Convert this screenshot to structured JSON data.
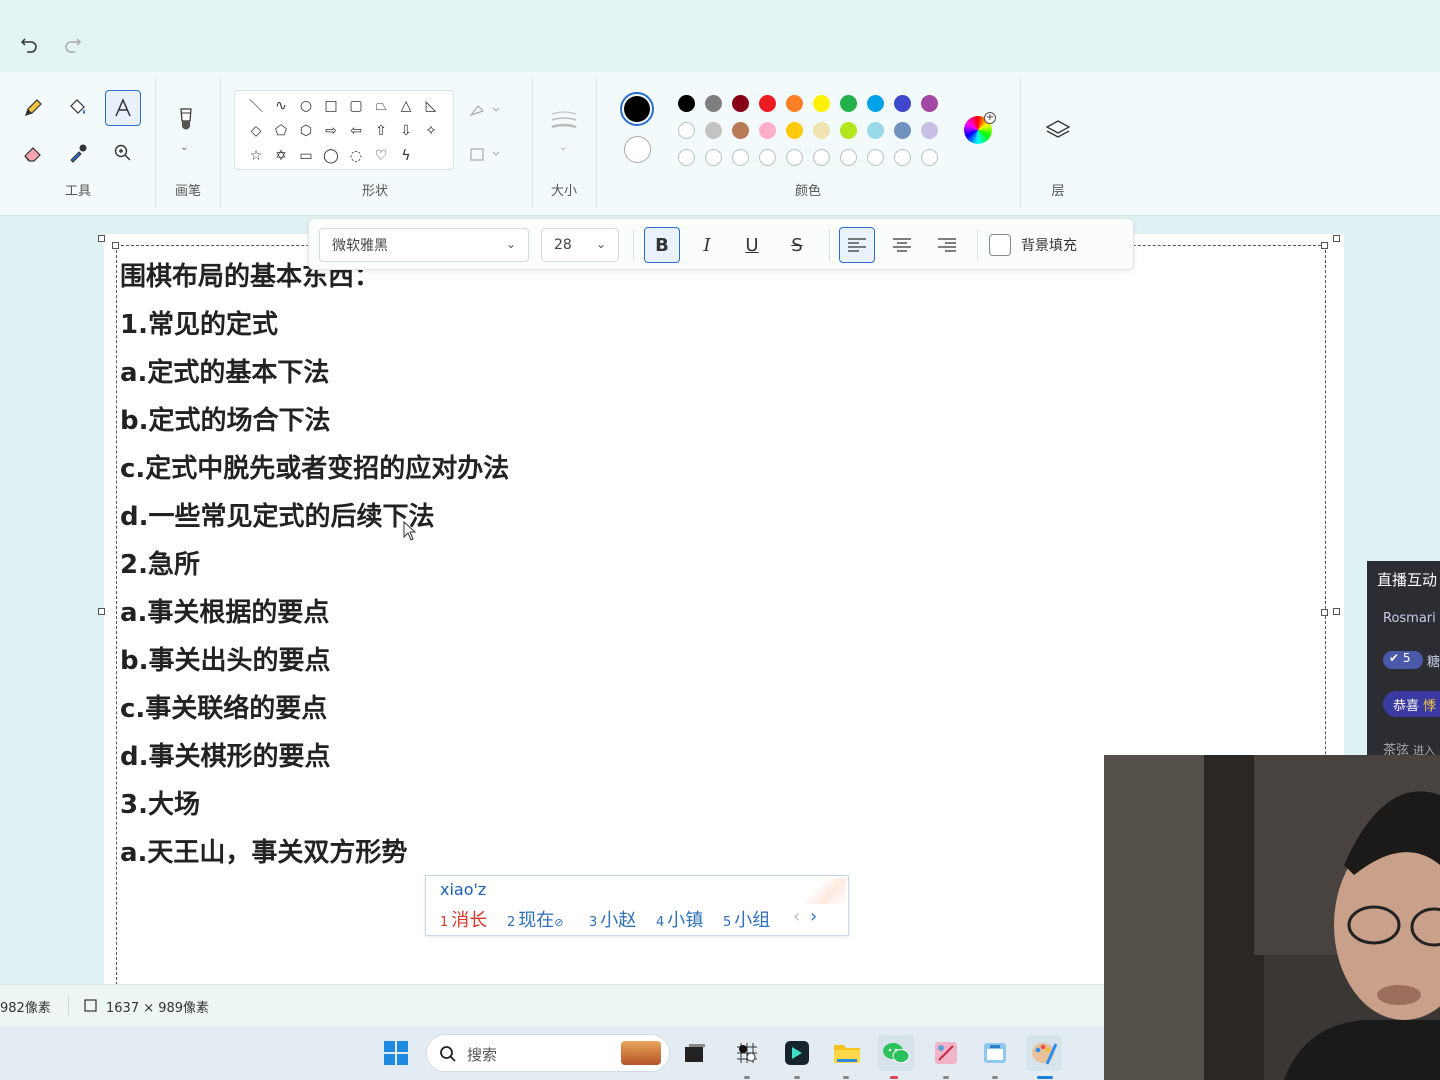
{
  "toolbar": {
    "groups": {
      "tools": "工具",
      "brush": "画笔",
      "shapes": "形状",
      "size": "大小",
      "colors": "颜色",
      "layers": "层"
    }
  },
  "colors": {
    "primary": "#000000",
    "secondary": "#ffffff",
    "palette_row1": [
      "#000000",
      "#7f7f7f",
      "#880015",
      "#ed1c24",
      "#ff7f27",
      "#fff200",
      "#22b14c",
      "#00a2e8",
      "#3f48cc",
      "#a349a4"
    ],
    "palette_row2": [
      "#ffffff",
      "#c3c3c3",
      "#b97a57",
      "#ffaec9",
      "#ffc90e",
      "#efe4b0",
      "#b5e61d",
      "#99d9ea",
      "#7092be",
      "#c8bfe7"
    ],
    "accent": "#2b6ed1"
  },
  "text_toolbar": {
    "font": "微软雅黑",
    "size": "28",
    "bold": "B",
    "italic": "I",
    "underline": "U",
    "strike": "S",
    "bg_fill": "背景填充"
  },
  "canvas_text": [
    "围棋布局的基本东西：",
    "1.常见的定式",
    "a.定式的基本下法",
    "b.定式的场合下法",
    "c.定式中脱先或者变招的应对办法",
    "d.一些常见定式的后续下法",
    "2.急所",
    "a.事关根据的要点",
    "b.事关出头的要点",
    "c.事关联络的要点",
    "d.事关棋形的要点",
    "3.大场",
    "a.天王山，事关双方形势"
  ],
  "ime": {
    "input": "xiao'z",
    "candidates": [
      {
        "num": "1",
        "text": "消长"
      },
      {
        "num": "2",
        "text": "现在"
      },
      {
        "num": "3",
        "text": "小赵"
      },
      {
        "num": "4",
        "text": "小镇"
      },
      {
        "num": "5",
        "text": "小组"
      }
    ],
    "prev": "‹",
    "next": "›"
  },
  "status": {
    "position": "982像素",
    "canvas_size": "1637 × 989像素"
  },
  "taskbar": {
    "search_placeholder": "搜索"
  },
  "chat": {
    "title": "直播互动",
    "user": "Rosmari",
    "badge": "5",
    "badge_suffix": "糖",
    "congrats": "恭喜",
    "congrats_suffix": "悸",
    "entry": "茶弦",
    "entry_suffix": "进入"
  }
}
